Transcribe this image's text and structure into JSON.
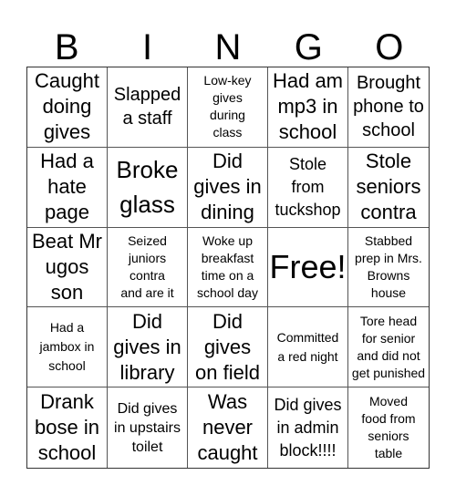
{
  "header": {
    "letters": [
      "B",
      "I",
      "N",
      "G",
      "O"
    ]
  },
  "cells": [
    {
      "text": "Caught\ndoing\ngives",
      "size": "s-l"
    },
    {
      "text": "Slapped\na staff",
      "size": "s-lm"
    },
    {
      "text": "Low-key\ngives\nduring\nclass",
      "size": "s-xs"
    },
    {
      "text": "Had am\nmp3 in\nschool",
      "size": "s-l"
    },
    {
      "text": "Brought\nphone to\nschool",
      "size": "s-lm"
    },
    {
      "text": "Had a\nhate\npage",
      "size": "s-l"
    },
    {
      "text": "Broke\nglass",
      "size": "s-big"
    },
    {
      "text": "Did\ngives in\ndining",
      "size": "s-l"
    },
    {
      "text": "Stole\nfrom\ntuckshop",
      "size": "s-m"
    },
    {
      "text": "Stole\nseniors\ncontra",
      "size": "s-l"
    },
    {
      "text": "Beat Mr\nugos\nson",
      "size": "s-l"
    },
    {
      "text": "Seized\njuniors\ncontra\nand are it",
      "size": "s-xs"
    },
    {
      "text": "Woke up\nbreakfast\ntime on a\nschool day",
      "size": "s-xs"
    },
    {
      "text": "Free!",
      "size": "s-xl"
    },
    {
      "text": "Stabbed\nprep in Mrs.\nBrowns\nhouse",
      "size": "s-xs"
    },
    {
      "text": "Had a\njambox in\nschool",
      "size": "s-s"
    },
    {
      "text": "Did\ngives in\nlibrary",
      "size": "s-l"
    },
    {
      "text": "Did\ngives\non field",
      "size": "s-l"
    },
    {
      "text": "Committed\na red night",
      "size": "s-s"
    },
    {
      "text": "Tore head\nfor senior\nand did not\nget punished",
      "size": "s-xs"
    },
    {
      "text": "Drank\nbose in\nschool",
      "size": "s-l"
    },
    {
      "text": "Did gives\nin upstairs\ntoilet",
      "size": "s-sm"
    },
    {
      "text": "Was\nnever\ncaught",
      "size": "s-l"
    },
    {
      "text": "Did gives\nin admin\nblock!!!!",
      "size": "s-m"
    },
    {
      "text": "Moved\nfood from\nseniors\ntable",
      "size": "s-xs"
    }
  ]
}
